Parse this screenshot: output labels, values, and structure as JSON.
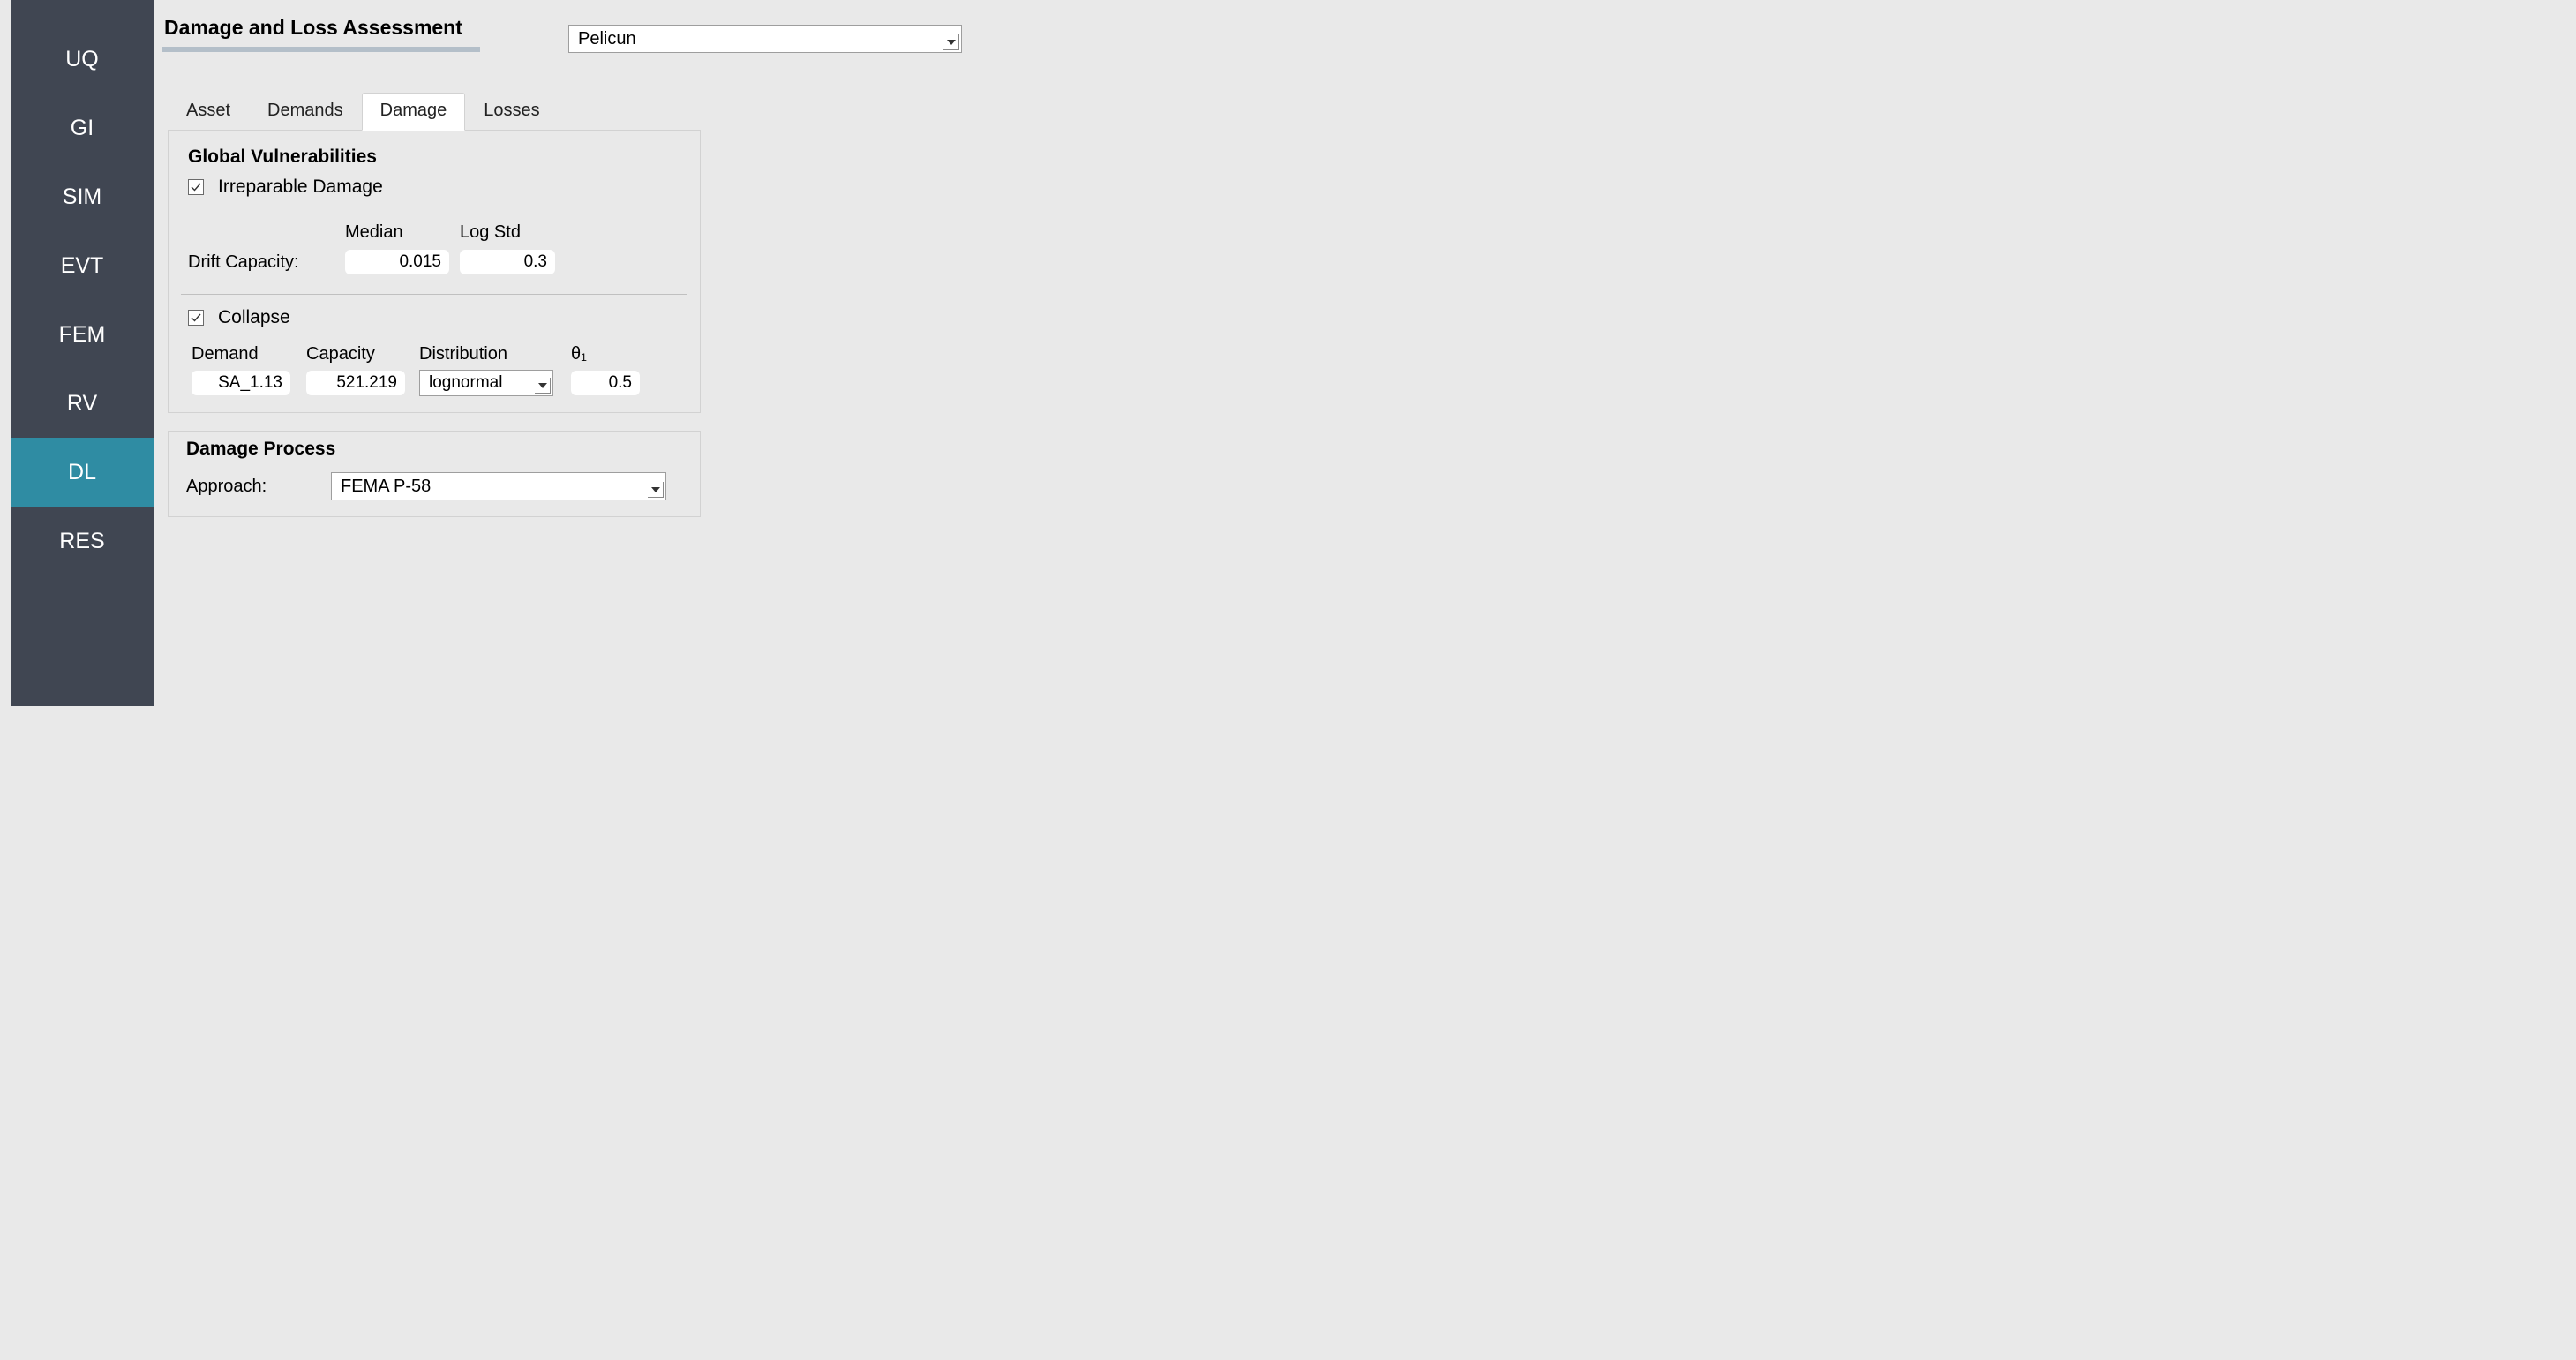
{
  "sidebar": {
    "items": [
      {
        "label": "UQ",
        "active": false
      },
      {
        "label": "GI",
        "active": false
      },
      {
        "label": "SIM",
        "active": false
      },
      {
        "label": "EVT",
        "active": false
      },
      {
        "label": "FEM",
        "active": false
      },
      {
        "label": "RV",
        "active": false
      },
      {
        "label": "DL",
        "active": true
      },
      {
        "label": "RES",
        "active": false
      }
    ]
  },
  "header": {
    "title": "Damage and Loss Assessment",
    "method": "Pelicun"
  },
  "tabs": [
    {
      "label": "Asset",
      "active": false
    },
    {
      "label": "Demands",
      "active": false
    },
    {
      "label": "Damage",
      "active": true
    },
    {
      "label": "Losses",
      "active": false
    }
  ],
  "damage": {
    "global_title": "Global Vulnerabilities",
    "irreparable": {
      "checked": true,
      "label": "Irreparable Damage",
      "headers": {
        "median": "Median",
        "logstd": "Log Std"
      },
      "row_label": "Drift Capacity:",
      "median": "0.015",
      "logstd": "0.3"
    },
    "collapse": {
      "checked": true,
      "label": "Collapse",
      "headers": {
        "demand": "Demand",
        "capacity": "Capacity",
        "distribution": "Distribution",
        "theta1": "θ₁"
      },
      "demand": "SA_1.13",
      "capacity": "521.219",
      "distribution": "lognormal",
      "theta1": "0.5"
    }
  },
  "damage_process": {
    "title": "Damage Process",
    "approach_label": "Approach:",
    "approach": "FEMA P-58"
  }
}
